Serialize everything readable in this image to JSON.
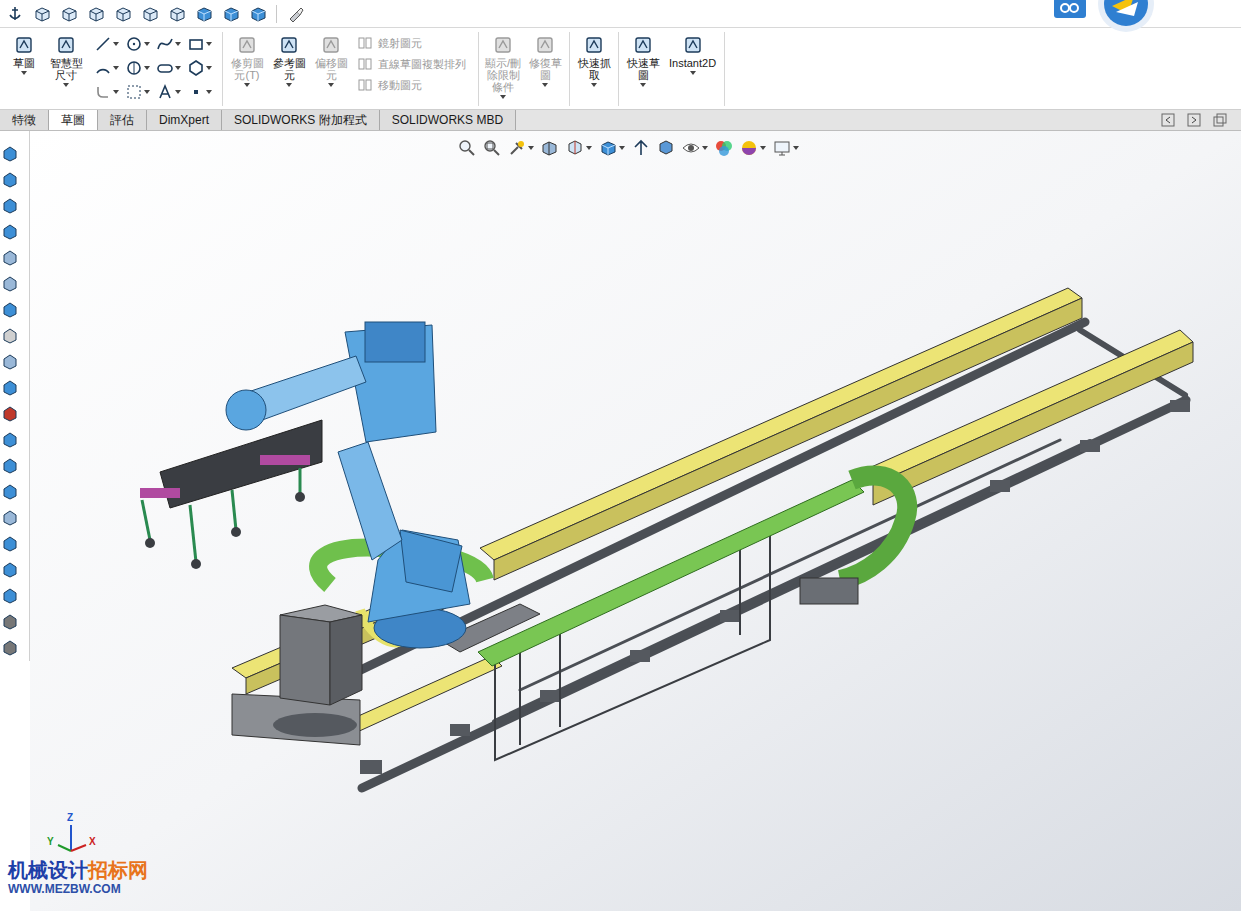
{
  "ribbon": {
    "groups": [
      {
        "items": [
          {
            "kind": "large",
            "label": "草圖",
            "disabled": false
          },
          {
            "kind": "large",
            "label": "智慧型尺寸",
            "disabled": false
          },
          {
            "kind": "tools",
            "label": "",
            "disabled": false
          }
        ]
      },
      {
        "items": [
          {
            "kind": "large",
            "label": "修剪圖元(T)",
            "disabled": true
          },
          {
            "kind": "large",
            "label": "參考圖元",
            "disabled": false
          },
          {
            "kind": "large",
            "label": "偏移圖元",
            "disabled": true
          },
          {
            "kind": "stack",
            "label": "",
            "disabled": true,
            "items": [
              {
                "label": "鏡射圖元",
                "disabled": true
              },
              {
                "label": "直線草圖複製排列",
                "disabled": true
              },
              {
                "label": "移動圖元",
                "disabled": true
              }
            ]
          }
        ]
      },
      {
        "items": [
          {
            "kind": "large",
            "label": "顯示/刪除限制條件",
            "disabled": true
          },
          {
            "kind": "large",
            "label": "修復草圖",
            "disabled": true
          }
        ]
      },
      {
        "items": [
          {
            "kind": "large",
            "label": "快速抓取",
            "disabled": false
          }
        ]
      },
      {
        "items": [
          {
            "kind": "large",
            "label": "快速草圖",
            "disabled": false
          },
          {
            "kind": "large",
            "label": "Instant2D",
            "disabled": false
          }
        ]
      }
    ]
  },
  "tabs": [
    {
      "label": "特徵",
      "selected": false
    },
    {
      "label": "草圖",
      "selected": true
    },
    {
      "label": "評估",
      "selected": false
    },
    {
      "label": "DimXpert",
      "selected": false
    },
    {
      "label": "SOLIDWORKS 附加程式",
      "selected": false
    },
    {
      "label": "SOLIDWORKS MBD",
      "selected": false
    }
  ],
  "watermark": {
    "parts": [
      {
        "text": "机械设计",
        "color": "#1e3fa8"
      },
      {
        "text": "招标网",
        "color": "#e8741c"
      }
    ],
    "url": "WWW.MEZBW.COM"
  },
  "triad": {
    "axes": [
      {
        "label": "Z",
        "color": "#2255cc"
      },
      {
        "label": "Y",
        "color": "#1f9a2a"
      },
      {
        "label": "X",
        "color": "#cc2222"
      }
    ]
  }
}
